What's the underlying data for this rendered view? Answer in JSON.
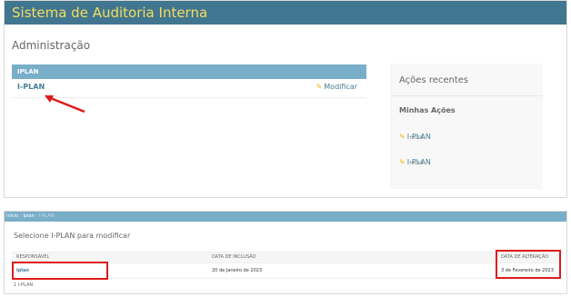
{
  "admin": {
    "site_title": "Sistema de Auditoria Interna",
    "page_title": "Administração",
    "module": {
      "caption": "IPLAN",
      "link": "I-PLAN",
      "change_label": "Modificar"
    },
    "recent": {
      "title": "Ações recentes",
      "my_actions": "Minhas Ações",
      "items": [
        {
          "label": "I-PLAN",
          "sub": "IPLAN"
        },
        {
          "label": "I-PLAN",
          "sub": "IPLAN"
        }
      ]
    }
  },
  "changelist": {
    "breadcrumbs": [
      "Início",
      "Iplan",
      "I-PLAN"
    ],
    "breadcrumb_sep": "›",
    "title": "Selecione I-PLAN para modificar",
    "columns": [
      "RESPONSÁVEL",
      "DATA DE INCLUSÃO",
      "DATA DE ALTERAÇÃO"
    ],
    "rows": [
      {
        "responsavel": "iplan",
        "inclusao": "20 de Janeiro de 2023",
        "alteracao": "3 de Fevereiro de 2023"
      }
    ],
    "count": "1 I-PLAN"
  },
  "colors": {
    "header_bg": "#417690",
    "header_text": "#f5dd5d",
    "module_caption_bg": "#79aec8",
    "link": "#447e9b",
    "highlight": "#e01a1a"
  }
}
